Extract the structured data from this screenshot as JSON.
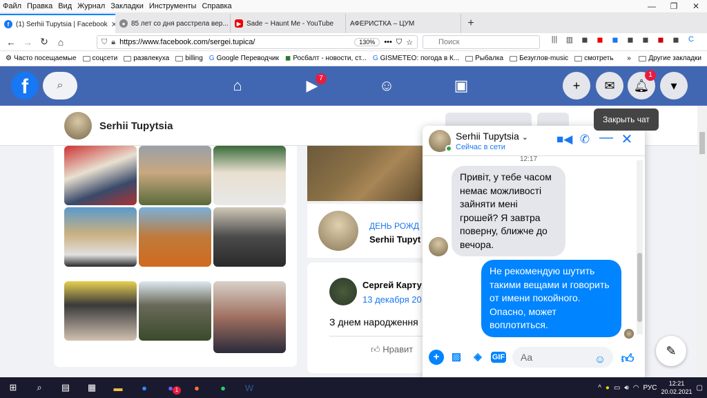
{
  "menubar": {
    "items": [
      "Файл",
      "Правка",
      "Вид",
      "Журнал",
      "Закладки",
      "Инструменты",
      "Справка"
    ]
  },
  "tabs": [
    {
      "title": "(1) Serhii Tupytsia | Facebook",
      "active": true
    },
    {
      "title": "85 лет со дня расстрела вер..."
    },
    {
      "title": "Sade ~ Haunt Me - YouTube"
    },
    {
      "title": "АФЕРИСТКА – ЦУМ"
    }
  ],
  "url": {
    "value": "https://www.facebook.com/sergei.tupica/",
    "zoom": "130%"
  },
  "search": {
    "placeholder": "Поиск"
  },
  "bookmarks": [
    "Часто посещаемые",
    "соцсети",
    "развлекуха",
    "billing",
    "Google Переводчик",
    "Росбалт - новости, ст...",
    "GISMETEO: погода в К...",
    "Рыбалка",
    "Безуглов-music",
    "смотреть",
    "Другие закладки"
  ],
  "fb": {
    "video_badge": "7",
    "notif_badge": "1"
  },
  "profile": {
    "name": "Serhii Tupytsia"
  },
  "birthday": {
    "label": "ДЕНЬ РОЖД",
    "name": "Serhii Tupyt"
  },
  "post": {
    "author": "Сергей Карту",
    "date": "13 декабря 20",
    "text": "З днем народження",
    "like": "Нравит"
  },
  "chat": {
    "name": "Serhii Tupytsia",
    "status": "Сейчас в сети",
    "time": "12:17",
    "incoming": "Привіт, у тебе часом немає можливості зайняти мені грошей? Я завтра поверну, ближче до вечора.",
    "outgoing": "Не рекомендую шутить такими вещами и говорить от имени покойного. Опасно, может воплотиться.",
    "input_placeholder": "Aa",
    "gif": "GIF"
  },
  "tooltip": "Закрыть чат",
  "taskbar": {
    "lang": "РУС",
    "time": "12:21",
    "date": "20.02.2021",
    "viber_badge": "1"
  }
}
